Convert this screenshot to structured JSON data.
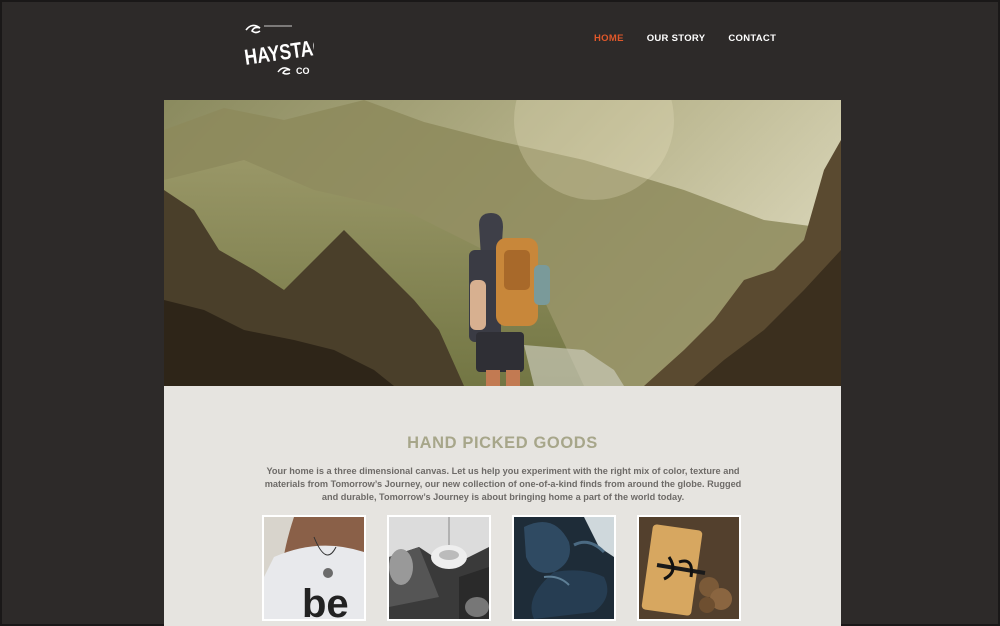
{
  "brand": {
    "name": "HAYSTACK",
    "suffix": "CO"
  },
  "nav": {
    "items": [
      {
        "label": "HOME",
        "active": true
      },
      {
        "label": "OUR STORY",
        "active": false
      },
      {
        "label": "CONTACT",
        "active": false
      }
    ]
  },
  "hero": {
    "image": "hiker-mountain-valley-photo"
  },
  "section": {
    "heading": "HAND PICKED GOODS",
    "description": "Your home is a three dimensional canvas. Let us help you experiment with the right mix of color, texture and materials from Tomorrow’s Journey, our new collection of one-of-a-kind finds from around the globe. Rugged and durable, Tomorrow’s Journey is about bringing home a part of the world today."
  },
  "products": [
    {
      "image": "person-necklace-shirt-photo"
    },
    {
      "image": "pendant-lamp-photo"
    },
    {
      "image": "blue-chair-photo"
    },
    {
      "image": "gift-box-pinecones-photo"
    }
  ],
  "colors": {
    "background": "#2d2a29",
    "accent": "#e0582a",
    "heading": "#a7a68a",
    "panel": "#e6e4e0"
  }
}
